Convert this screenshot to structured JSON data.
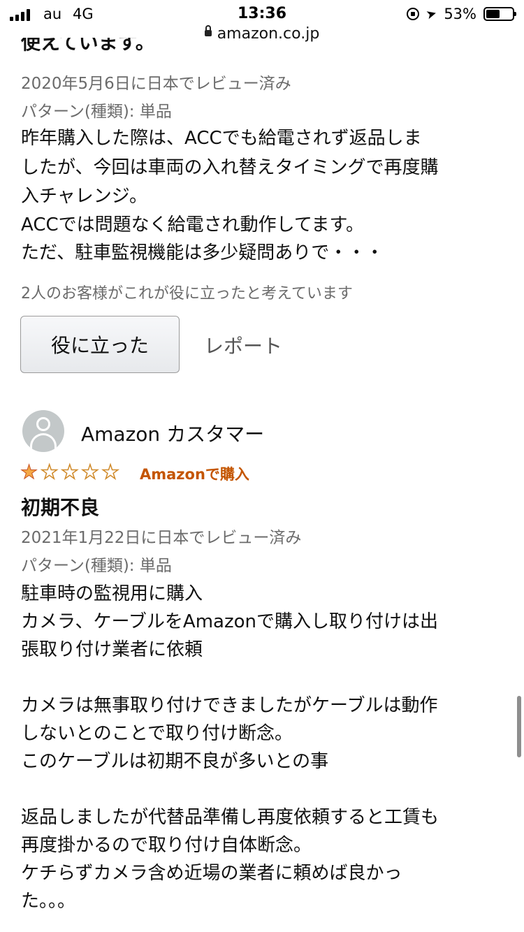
{
  "status_bar": {
    "carrier": "au",
    "network": "4G",
    "time": "13:36",
    "battery_percent_label": "53%",
    "battery_level": 0.53
  },
  "url_bar": {
    "domain": "amazon.co.jp"
  },
  "previous_review": {
    "title_fragment": "使えています。",
    "date": "2020年5月6日に日本でレビュー済み",
    "variant": "パターン(種類): 単品",
    "body_lines": [
      "昨年購入した際は、ACCでも給電されず返品しま",
      "したが、今回は車両の入れ替えタイミングで再度購",
      "入チャレンジ。",
      "ACCでは問題なく給電され動作してます。",
      "ただ、駐車監視機能は多少疑問ありで・・・"
    ],
    "helpful_count": "2人のお客様がこれが役に立ったと考えています",
    "helpful_button": "役に立った",
    "report_link": "レポート"
  },
  "review": {
    "reviewer_name": "Amazon カスタマー",
    "rating": 1,
    "rating_max": 5,
    "verified_label": "Amazonで購入",
    "title": "初期不良",
    "date": "2021年1月22日に日本でレビュー済み",
    "variant": "パターン(種類): 単品",
    "body_lines": [
      "駐車時の監視用に購入",
      "カメラ、ケーブルをAmazonで購入し取り付けは出",
      "張取り付け業者に依頼",
      "",
      "カメラは無事取り付けできましたがケーブルは動作",
      "しないとのことで取り付け断念。",
      "このケーブルは初期不良が多いとの事",
      "",
      "返品しましたが代替品準備し再度依頼すると工賃も",
      "再度掛かるので取り付け自体断念。",
      "ケチらずカメラ含め近場の業者に頼めば良かっ",
      "た。。。"
    ]
  },
  "colors": {
    "star": "#f3a847",
    "verified": "#c45500",
    "meta_text": "#6b6b6b"
  }
}
